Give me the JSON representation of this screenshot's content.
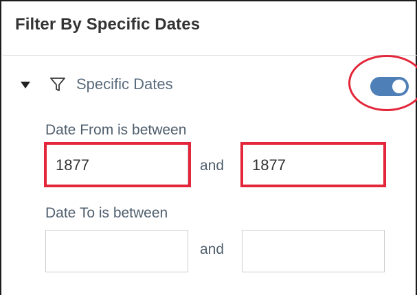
{
  "panel": {
    "title": "Filter By Specific Dates"
  },
  "section": {
    "label": "Specific Dates",
    "expanded": true,
    "caret_icon": "caret-down-icon",
    "filter_icon": "funnel-filter-icon",
    "toggle": {
      "state": "on",
      "color": "#4f7fb7"
    }
  },
  "date_from": {
    "label": "Date From is between",
    "start_value": "1877",
    "start_placeholder": "",
    "connector": "and",
    "end_value": "1877",
    "end_placeholder": ""
  },
  "date_to": {
    "label": "Date To is between",
    "start_value": "",
    "start_placeholder": "",
    "connector": "and",
    "end_value": "",
    "end_placeholder": ""
  },
  "annotations": {
    "highlight_color": "#e3263a"
  }
}
